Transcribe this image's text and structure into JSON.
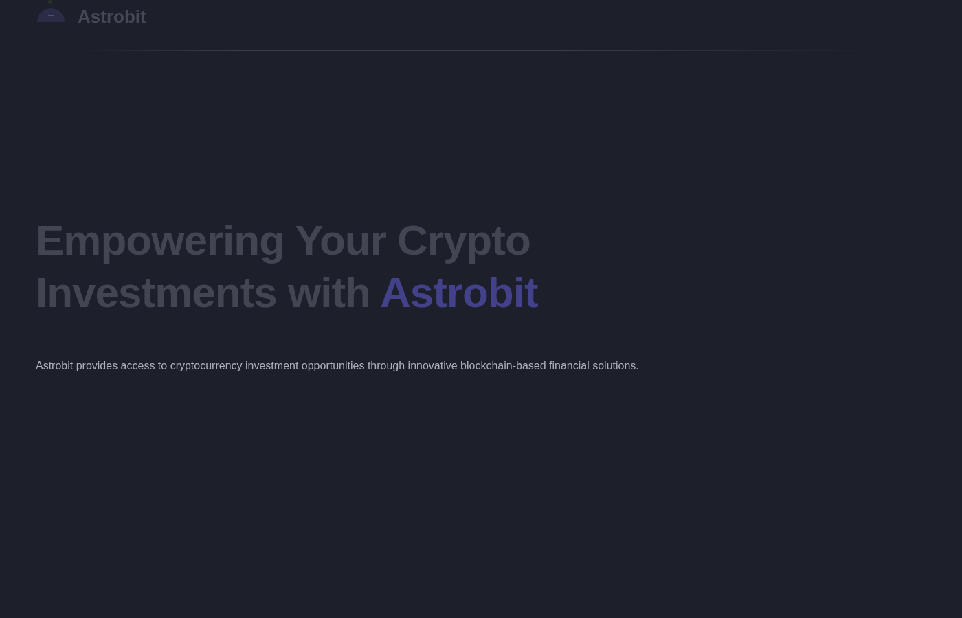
{
  "header": {
    "logo": {
      "name": "Astrobit"
    }
  },
  "hero": {
    "title": [
      {
        "text": "Empowering Your Crypto Investments with ",
        "kind": "plain"
      },
      {
        "text": "Astrobit",
        "kind": "accent"
      }
    ],
    "description": "Astrobit provides access to cryptocurrency investment opportunities through innovative blockchain-based financial solutions."
  }
}
